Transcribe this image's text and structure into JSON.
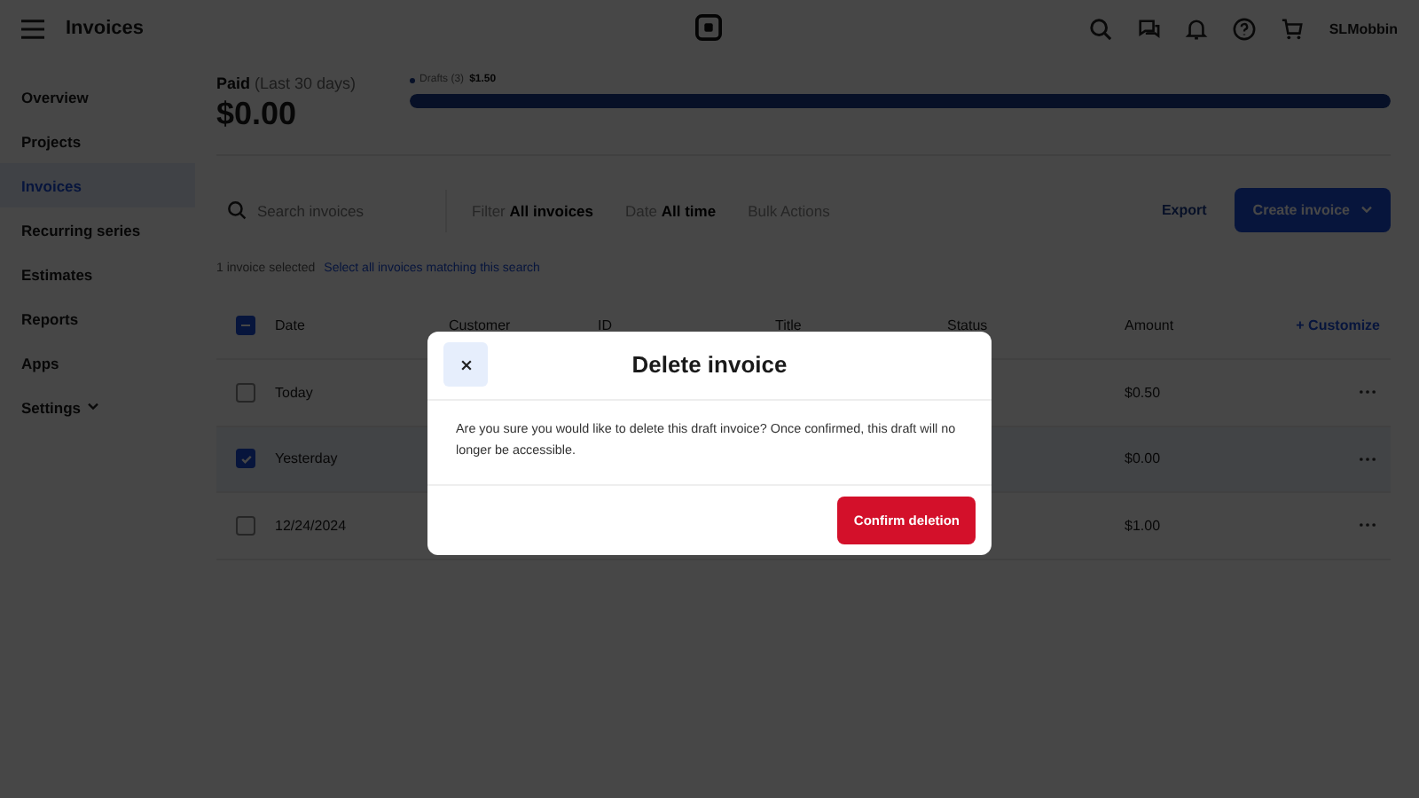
{
  "topbar": {
    "title": "Invoices",
    "user": "SLMobbin"
  },
  "sidebar": {
    "items": [
      {
        "label": "Overview",
        "selected": false
      },
      {
        "label": "Projects",
        "selected": false
      },
      {
        "label": "Invoices",
        "selected": true
      },
      {
        "label": "Recurring series",
        "selected": false
      },
      {
        "label": "Estimates",
        "selected": false
      },
      {
        "label": "Reports",
        "selected": false
      },
      {
        "label": "Apps",
        "selected": false
      },
      {
        "label": "Settings",
        "selected": false,
        "expandable": true
      }
    ]
  },
  "summary": {
    "label": "Paid",
    "period": "(Last 30 days)",
    "amount": "$0.00",
    "legend": "Drafts (3)",
    "legend_amount": "$1.50",
    "level": 1
  },
  "filters": {
    "search_placeholder": "Search invoices",
    "filter_label": "Filter",
    "filter_value": "All invoices",
    "date_label": "Date",
    "date_value": "All time",
    "bulk": "Bulk Actions",
    "export": "Export",
    "create": "Create invoice"
  },
  "selection": {
    "text": "1 invoice selected",
    "link": "Select all invoices matching this search"
  },
  "table": {
    "columns": [
      "Date",
      "Customer",
      "ID",
      "Title",
      "Status",
      "Amount"
    ],
    "customize": "+ Customize",
    "header_indeterminate": true,
    "rows": [
      {
        "date": "Today",
        "amount": "$0.50",
        "checked": false
      },
      {
        "date": "Yesterday",
        "amount": "$0.00",
        "checked": true
      },
      {
        "date": "12/24/2024",
        "amount": "$1.00",
        "checked": false
      }
    ]
  },
  "dialog": {
    "title": "Delete invoice",
    "message": "Are you sure you would like to delete this draft invoice? Once confirmed, this draft will no longer be accessible.",
    "confirm": "Confirm deletion"
  }
}
